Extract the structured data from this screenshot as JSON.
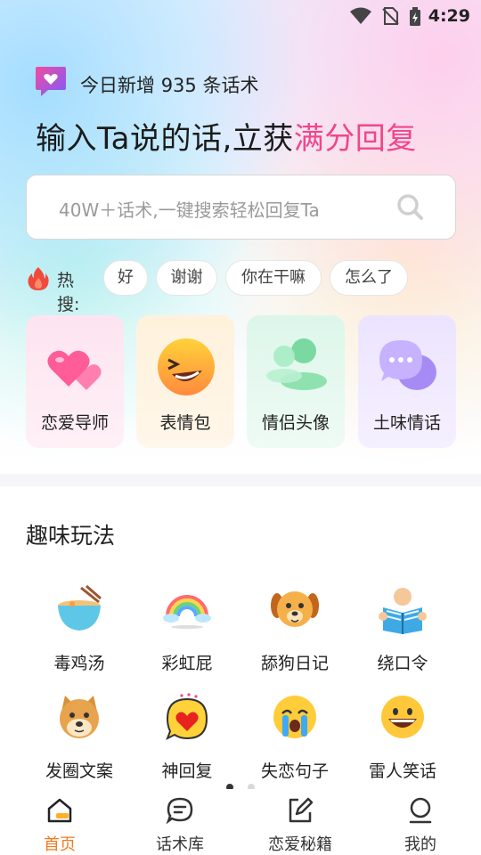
{
  "status": {
    "time": "4:29"
  },
  "header": {
    "new_prefix": "今日新增",
    "new_count": "935",
    "new_suffix": "条话术",
    "headline_main": "输入Ta说的话,立获",
    "headline_highlight": "满分回复"
  },
  "search": {
    "placeholder": "40W＋话术,一键搜索轻松回复Ta"
  },
  "hot": {
    "label": "热搜:",
    "tags": [
      "好",
      "谢谢",
      "你在干嘛",
      "怎么了"
    ]
  },
  "features": [
    {
      "label": "恋爱导师",
      "icon": "hearts-icon"
    },
    {
      "label": "表情包",
      "icon": "laughing-face-icon"
    },
    {
      "label": "情侣头像",
      "icon": "couple-avatar-icon"
    },
    {
      "label": "土味情话",
      "icon": "chat-bubbles-icon"
    }
  ],
  "fun": {
    "title": "趣味玩法",
    "items": [
      {
        "label": "毒鸡汤",
        "icon": "noodle-bowl-icon"
      },
      {
        "label": "彩虹屁",
        "icon": "rainbow-icon"
      },
      {
        "label": "舔狗日记",
        "icon": "dog-face-icon"
      },
      {
        "label": "绕口令",
        "icon": "reading-book-icon"
      },
      {
        "label": "发圈文案",
        "icon": "doge-icon"
      },
      {
        "label": "神回复",
        "icon": "heart-bubble-icon"
      },
      {
        "label": "失恋句子",
        "icon": "crying-face-icon"
      },
      {
        "label": "雷人笑话",
        "icon": "grinning-face-icon"
      }
    ]
  },
  "tabs": [
    {
      "label": "首页",
      "icon": "home-icon",
      "active": true
    },
    {
      "label": "话术库",
      "icon": "chat-icon",
      "active": false
    },
    {
      "label": "恋爱秘籍",
      "icon": "edit-icon",
      "active": false
    },
    {
      "label": "我的",
      "icon": "profile-icon",
      "active": false
    }
  ],
  "colors": {
    "accent": "#f0468c",
    "tab_active": "#f47a1e"
  }
}
